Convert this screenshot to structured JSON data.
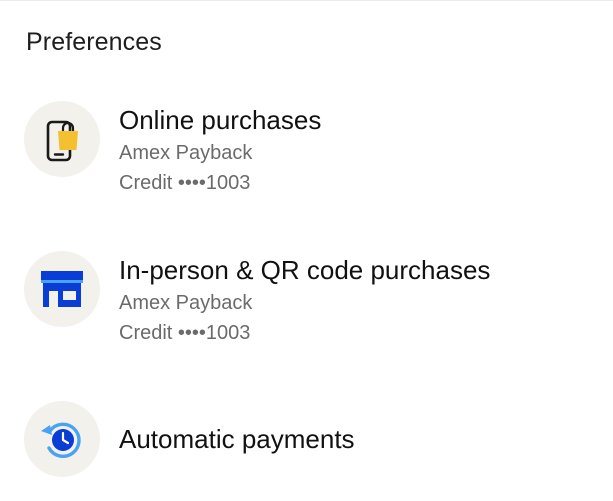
{
  "section_title": "Preferences",
  "items": [
    {
      "title": "Online purchases",
      "subtitle_1": "Amex Payback",
      "subtitle_2": "Credit ••••1003",
      "icon": "phone-shopping-bag-icon"
    },
    {
      "title": "In-person & QR code purchases",
      "subtitle_1": "Amex Payback",
      "subtitle_2": "Credit ••••1003",
      "icon": "storefront-icon"
    },
    {
      "title": "Automatic payments",
      "icon": "clock-refresh-icon"
    }
  ],
  "colors": {
    "icon_background": "#f2f1ec",
    "accent_blue": "#0a3cd6",
    "accent_yellow": "#f5c02f",
    "light_blue": "#4aa3f0",
    "subtitle_gray": "#6b6b6b"
  }
}
